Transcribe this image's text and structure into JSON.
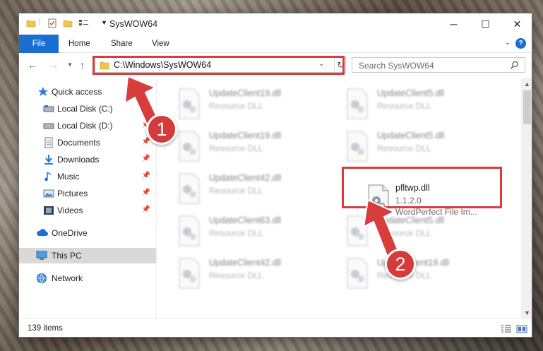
{
  "window": {
    "title": "SysWOW64",
    "controls": {
      "minimize": "─",
      "maximize": "☐",
      "close": "✕"
    }
  },
  "ribbon": {
    "tabs": [
      {
        "label": "File"
      },
      {
        "label": "Home"
      },
      {
        "label": "Share"
      },
      {
        "label": "View"
      }
    ],
    "help_label": "?"
  },
  "address_bar": {
    "path": "C:\\Windows\\SysWOW64"
  },
  "search": {
    "placeholder": "Search SysWOW64"
  },
  "sidebar": {
    "items": [
      {
        "label": "Quick access",
        "icon": "star-icon"
      },
      {
        "label": "Local Disk (C:)",
        "icon": "drive-icon"
      },
      {
        "label": "Local Disk (D:)",
        "icon": "drive-icon"
      },
      {
        "label": "Documents",
        "icon": "documents-icon"
      },
      {
        "label": "Downloads",
        "icon": "download-icon"
      },
      {
        "label": "Music",
        "icon": "music-icon"
      },
      {
        "label": "Pictures",
        "icon": "pictures-icon"
      },
      {
        "label": "Videos",
        "icon": "videos-icon"
      },
      {
        "label": "OneDrive",
        "icon": "cloud-icon"
      },
      {
        "label": "This PC",
        "icon": "pc-icon"
      },
      {
        "label": "Network",
        "icon": "network-icon"
      }
    ]
  },
  "files": [
    {
      "name": "UpdateClient19.dll",
      "desc": "Resource DLL"
    },
    {
      "name": "UpdateClient5.dll",
      "desc": "Resource DLL"
    },
    {
      "name": "UpdateClient19.dll",
      "desc": "Resource DLL"
    },
    {
      "name": "UpdateClient5.dll",
      "desc": "Resource DLL"
    },
    {
      "name": "UpdateClient42.dll",
      "desc": "Resource DLL"
    },
    {
      "name": "pfltwp.dll",
      "version": "1.1.2.0",
      "desc": "WordPerfect File Im..."
    },
    {
      "name": "UpdateClient63.dll",
      "desc": "Resource DLL"
    },
    {
      "name": "UpdateClient5.dll",
      "desc": "Resource DLL"
    },
    {
      "name": "UpdateClient42.dll",
      "desc": "Resource DLL"
    },
    {
      "name": "UpdateClient19.dll",
      "desc": "Resource DLL"
    }
  ],
  "status": {
    "item_count": "139 items"
  },
  "annotations": {
    "step1": "1",
    "step2": "2",
    "color": "#d73d3d"
  }
}
